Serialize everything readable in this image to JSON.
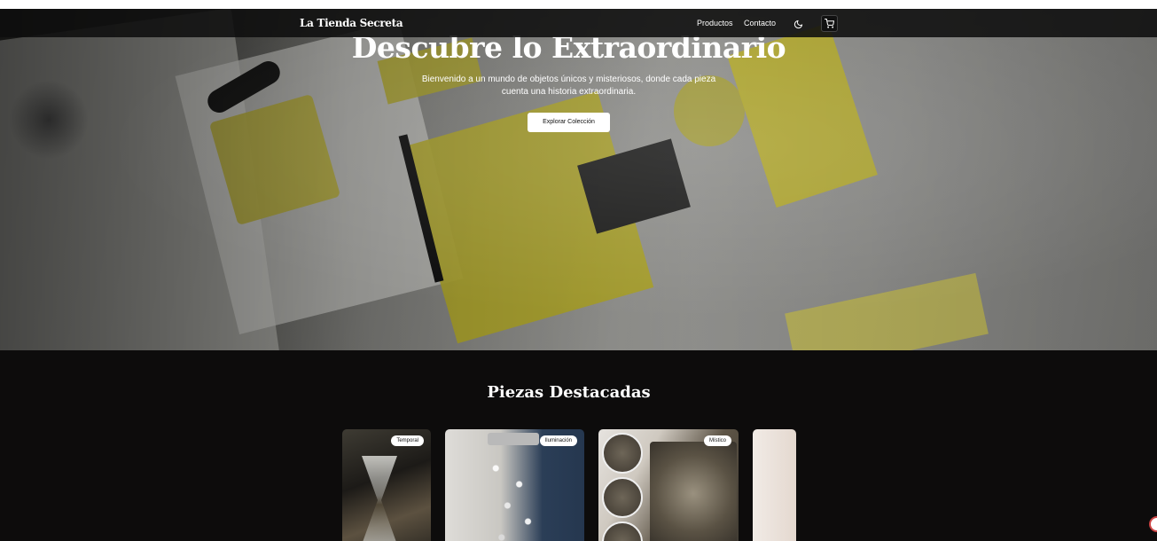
{
  "nav": {
    "brand": "La Tienda Secreta",
    "links": [
      "Productos",
      "Contacto"
    ],
    "icons": [
      "moon-icon",
      "cart-icon"
    ]
  },
  "hero": {
    "title": "Descubre lo Extraordinario",
    "subtitle": "Bienvenido a un mundo de objetos únicos y misteriosos, donde cada pieza cuenta una historia extraordinaria.",
    "cta": "Explorar Colección"
  },
  "featured": {
    "title": "Piezas Destacadas",
    "cards": [
      {
        "badge": "Temporal"
      },
      {
        "badge": "Iluminación"
      },
      {
        "badge": "Místico"
      },
      {
        "badge": ""
      }
    ]
  }
}
